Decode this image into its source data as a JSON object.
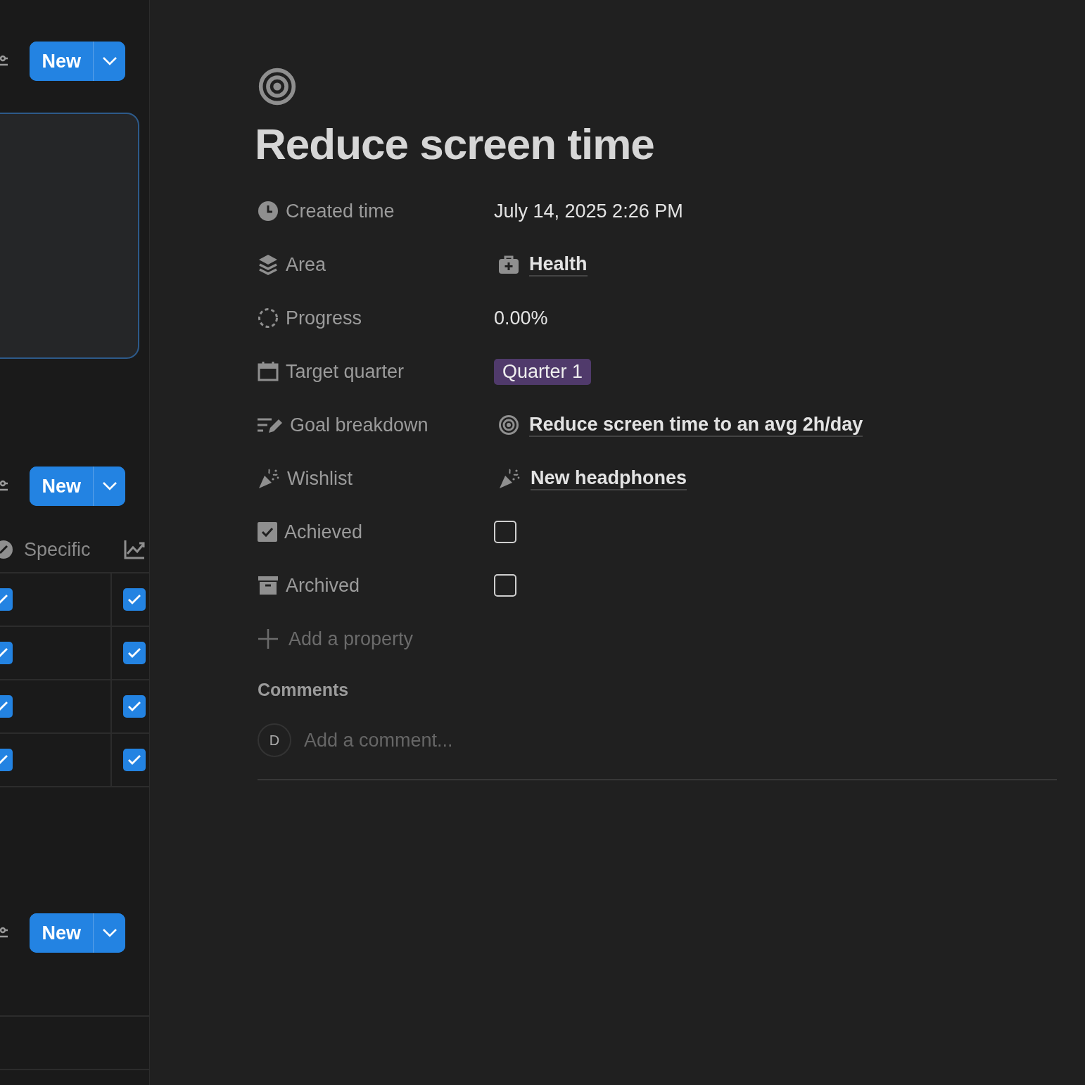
{
  "left_panel": {
    "sections": [
      {
        "kind": "card",
        "new_button": {
          "label": "New"
        }
      },
      {
        "kind": "table",
        "new_button": {
          "label": "New"
        },
        "table": {
          "header": {
            "label": "Specific"
          },
          "rows": [
            {
              "cells": [
                {
                  "checked": true
                },
                {
                  "checked": true
                }
              ]
            },
            {
              "cells": [
                {
                  "checked": true
                },
                {
                  "checked": true
                }
              ]
            },
            {
              "cells": [
                {
                  "checked": true
                },
                {
                  "checked": true
                }
              ]
            },
            {
              "cells": [
                {
                  "checked": true
                },
                {
                  "checked": true
                }
              ]
            }
          ]
        }
      },
      {
        "kind": "list",
        "new_button": {
          "label": "New"
        }
      }
    ]
  },
  "page": {
    "title": "Reduce screen time",
    "properties": [
      {
        "label": "Created time",
        "kind": "text",
        "value": "July 14, 2025 2:26 PM"
      },
      {
        "label": "Area",
        "kind": "relation",
        "value": "Health"
      },
      {
        "label": "Progress",
        "kind": "text",
        "value": "0.00%"
      },
      {
        "label": "Target quarter",
        "kind": "tag",
        "value": "Quarter 1",
        "color": "#503a6b"
      },
      {
        "label": "Goal breakdown",
        "kind": "relation",
        "value": "Reduce screen time to an avg 2h/day"
      },
      {
        "label": "Wishlist",
        "kind": "relation",
        "value": "New headphones"
      },
      {
        "label": "Achieved",
        "kind": "checkbox",
        "checked": false
      },
      {
        "label": "Archived",
        "kind": "checkbox",
        "checked": false
      }
    ],
    "add_property": "Add a property",
    "comments": {
      "heading": "Comments",
      "avatar": "D",
      "placeholder": "Add a comment..."
    }
  }
}
